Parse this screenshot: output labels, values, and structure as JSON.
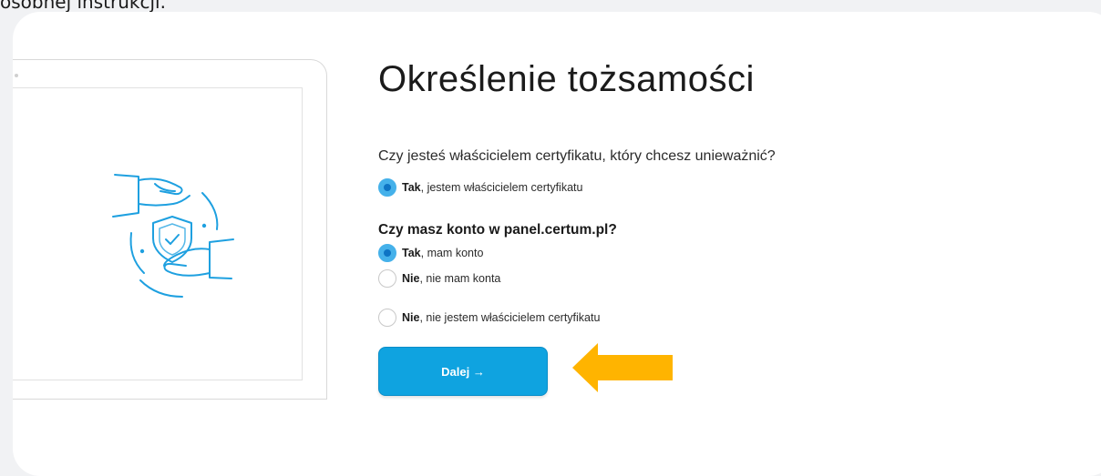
{
  "top_text": "osobnej instrukcji.",
  "page": {
    "title": "Określenie tożsamości"
  },
  "question_owner": "Czy jesteś właścicielem certyfikatu, który chcesz unieważnić?",
  "option_owner_yes": {
    "bold": "Tak",
    "rest": ", jestem właścicielem certyfikatu",
    "selected": true
  },
  "question_account": "Czy masz konto w panel.certum.pl?",
  "option_account_yes": {
    "bold": "Tak",
    "rest": ", mam konto",
    "selected": true
  },
  "option_account_no": {
    "bold": "Nie",
    "rest": ", nie mam konta",
    "selected": false
  },
  "option_owner_no": {
    "bold": "Nie",
    "rest": ", nie jestem właścicielem certyfikatu",
    "selected": false
  },
  "next_button": {
    "label": "Dalej →"
  },
  "colors": {
    "accent": "#0fa3e0",
    "radio_selected": "#45b1ea",
    "pointer_arrow": "#ffb400",
    "illustration_stroke": "#1ea0e0"
  },
  "icons": {
    "illustration": "hands-shield-check-icon",
    "pointer": "pointer-arrow-icon"
  }
}
